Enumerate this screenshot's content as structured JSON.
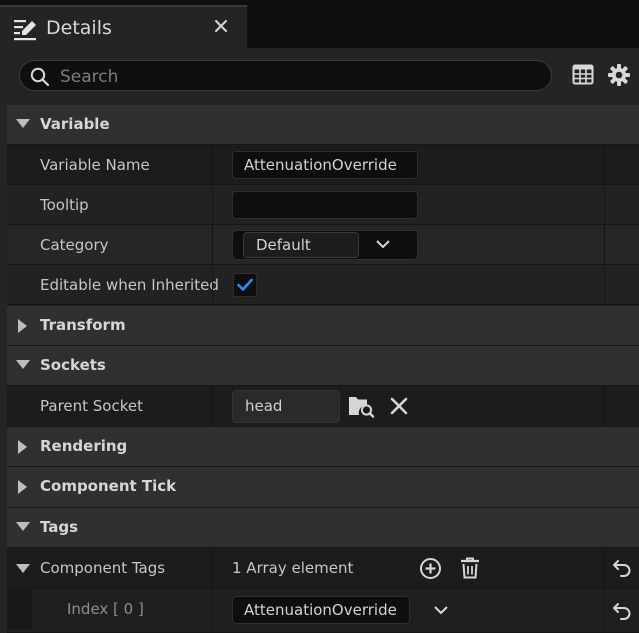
{
  "tab": {
    "title": "Details",
    "icon": "edit-details-icon"
  },
  "search": {
    "placeholder": "Search",
    "value": ""
  },
  "toolbar": {
    "icons": [
      "table-view-icon",
      "gear-icon"
    ]
  },
  "sections": {
    "variable": {
      "label": "Variable",
      "expanded": true,
      "properties": {
        "variable_name": {
          "label": "Variable Name",
          "value": "AttenuationOverride"
        },
        "tooltip": {
          "label": "Tooltip",
          "value": ""
        },
        "category": {
          "label": "Category",
          "value": "Default"
        },
        "editable_when_inherited": {
          "label": "Editable when Inherited",
          "checked": true
        }
      }
    },
    "transform": {
      "label": "Transform",
      "expanded": false
    },
    "sockets": {
      "label": "Sockets",
      "expanded": true,
      "properties": {
        "parent_socket": {
          "label": "Parent Socket",
          "value": "head"
        }
      }
    },
    "rendering": {
      "label": "Rendering",
      "expanded": false
    },
    "component_tick": {
      "label": "Component Tick",
      "expanded": false
    },
    "tags": {
      "label": "Tags",
      "expanded": true,
      "component_tags": {
        "label": "Component Tags",
        "summary": "1 Array element",
        "elements": [
          {
            "index_label": "Index [ 0 ]",
            "value": "AttenuationOverride"
          }
        ]
      }
    }
  },
  "colors": {
    "accent_check": "#2f8bff",
    "panel_bg": "#242424",
    "category_bg": "#303030"
  }
}
